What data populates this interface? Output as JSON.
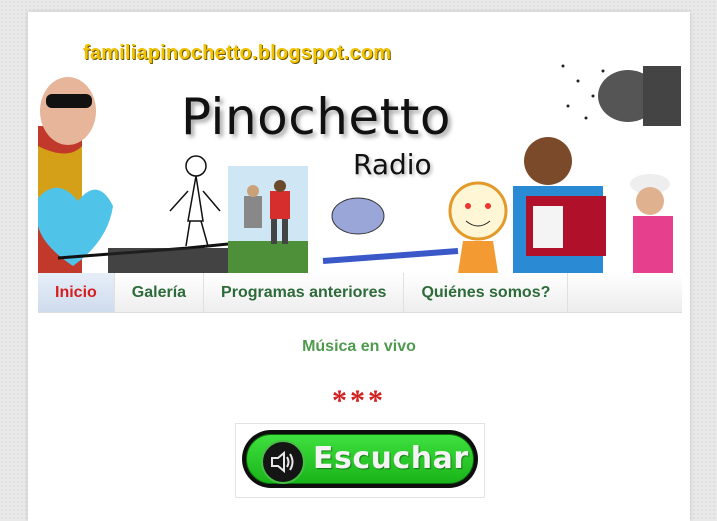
{
  "header": {
    "blog_url": "familiapinochetto.blogspot.com",
    "title": "Pinochetto",
    "subtitle": "Radio"
  },
  "nav": {
    "items": [
      {
        "label": "Inicio",
        "active": true
      },
      {
        "label": "Galería",
        "active": false
      },
      {
        "label": "Programas anteriores",
        "active": false
      },
      {
        "label": "Quiénes somos?",
        "active": false
      }
    ]
  },
  "main": {
    "section_title": "Música en vivo",
    "separator": "***",
    "listen_label": "Escuchar"
  },
  "colors": {
    "nav_text": "#2e6b3a",
    "nav_active": "#d61e1e",
    "section_title": "#4f9a4f",
    "separator": "#d32020",
    "button_green": "#19b419"
  }
}
